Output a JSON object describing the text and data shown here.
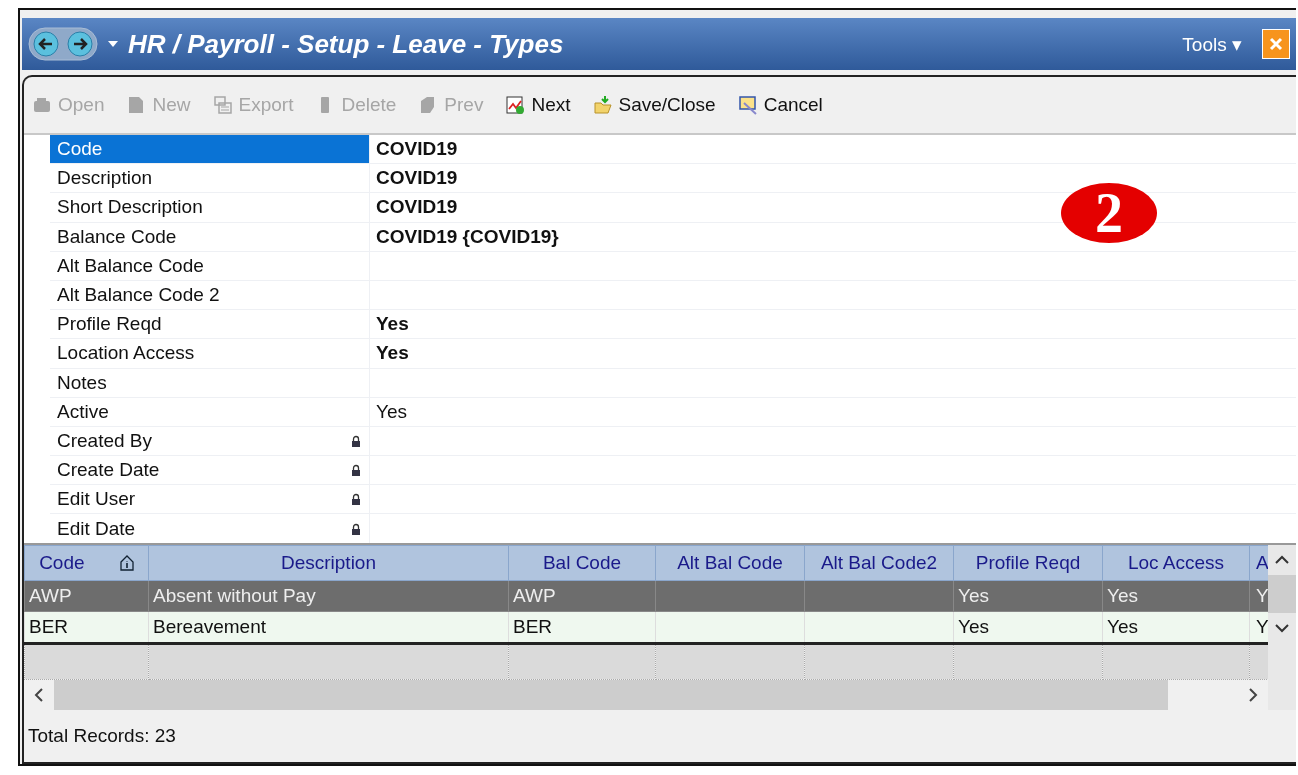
{
  "window": {
    "title": "HR / Payroll - Setup - Leave - Types",
    "tools_menu": "Tools ▾"
  },
  "toolbar": [
    {
      "label": "Open",
      "disabled": true
    },
    {
      "label": "New",
      "disabled": true
    },
    {
      "label": "Export",
      "disabled": true
    },
    {
      "label": "Delete",
      "disabled": true
    },
    {
      "label": "Prev",
      "disabled": true
    },
    {
      "label": "Next",
      "disabled": false
    },
    {
      "label": "Save/Close",
      "disabled": false
    },
    {
      "label": "Cancel",
      "disabled": false
    }
  ],
  "properties": [
    {
      "label": "Code",
      "value": "COVID19",
      "selected": true,
      "changed": true,
      "locked": false
    },
    {
      "label": "Description",
      "value": "COVID19",
      "selected": false,
      "changed": true,
      "locked": false
    },
    {
      "label": "Short Description",
      "value": "COVID19",
      "selected": false,
      "changed": true,
      "locked": false
    },
    {
      "label": "Balance Code",
      "value": "COVID19 {COVID19}",
      "selected": false,
      "changed": true,
      "locked": false
    },
    {
      "label": "Alt Balance Code",
      "selected": false,
      "locked": false
    },
    {
      "label": "Alt Balance Code 2",
      "selected": false,
      "locked": false
    },
    {
      "label": "Profile Reqd",
      "value": "Yes",
      "selected": false,
      "changed": true,
      "locked": false
    },
    {
      "label": "Location Access",
      "value": "Yes",
      "selected": false,
      "changed": true,
      "locked": false
    },
    {
      "label": "Notes",
      "selected": false,
      "locked": false
    },
    {
      "label": "Active",
      "value": "Yes",
      "selected": false,
      "changed": false,
      "locked": false
    },
    {
      "label": "Created By",
      "selected": false,
      "locked": true
    },
    {
      "label": "Create Date",
      "selected": false,
      "locked": true
    },
    {
      "label": "Edit User",
      "selected": false,
      "locked": true
    },
    {
      "label": "Edit Date",
      "selected": false,
      "locked": true
    }
  ],
  "step_marker": "2",
  "table": {
    "columns": [
      "Code",
      "Description",
      "Bal Code",
      "Alt Bal Code",
      "Alt Bal Code2",
      "Profile Reqd",
      "Loc Access",
      "A"
    ],
    "rows": [
      {
        "cells": [
          "AWP",
          "Absent without Pay",
          "AWP",
          "",
          "",
          "Yes",
          "Yes",
          "Y"
        ],
        "selected": true
      },
      {
        "cells": [
          "BER",
          "Bereavement",
          "BER",
          "",
          "",
          "Yes",
          "Yes",
          "Y"
        ],
        "selected": false
      }
    ]
  },
  "status_bar": "Total Records: 23"
}
